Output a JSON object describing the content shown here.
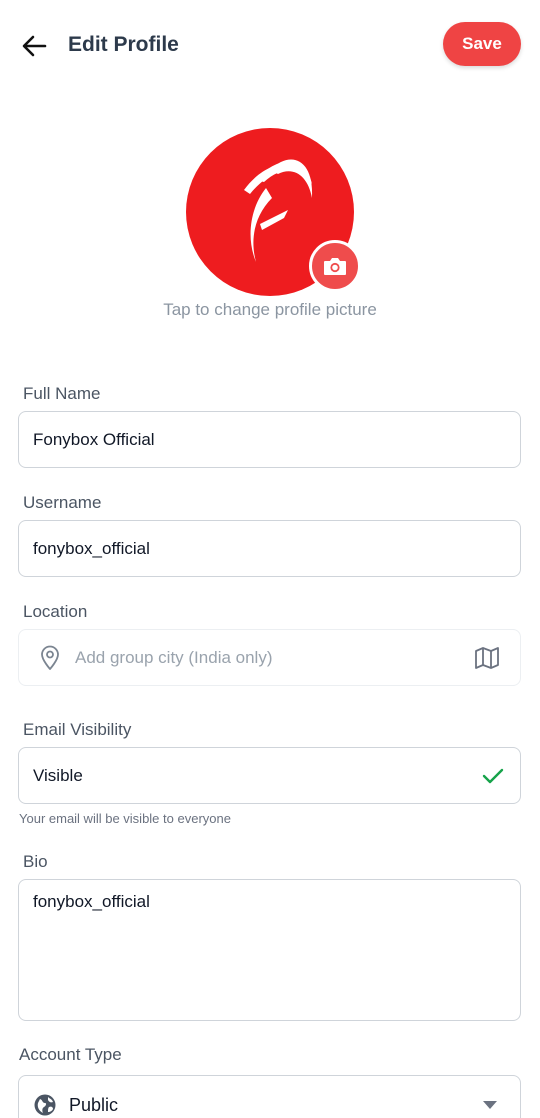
{
  "header": {
    "title": "Edit Profile",
    "save_label": "Save",
    "back_icon": "arrow-left-icon"
  },
  "avatar": {
    "hint": "Tap to change profile picture",
    "camera_icon": "camera-icon",
    "brand_color": "#ee1c1f"
  },
  "form": {
    "full_name": {
      "label": "Full Name",
      "value": "Fonybox Official"
    },
    "username": {
      "label": "Username",
      "value": "fonybox_official"
    },
    "location": {
      "label": "Location",
      "placeholder": "Add group city (India only)",
      "pin_icon": "map-pin-icon",
      "map_icon": "map-icon"
    },
    "email_visibility": {
      "label": "Email Visibility",
      "value": "Visible",
      "check_icon": "check-icon",
      "helper": "Your email will be visible to everyone"
    },
    "bio": {
      "label": "Bio",
      "value": "fonybox_official"
    },
    "account_type": {
      "label": "Account Type",
      "value": "Public",
      "globe_icon": "globe-icon",
      "caret_icon": "caret-down-icon"
    }
  },
  "colors": {
    "accent": "#ef4444",
    "success": "#16a34a"
  }
}
